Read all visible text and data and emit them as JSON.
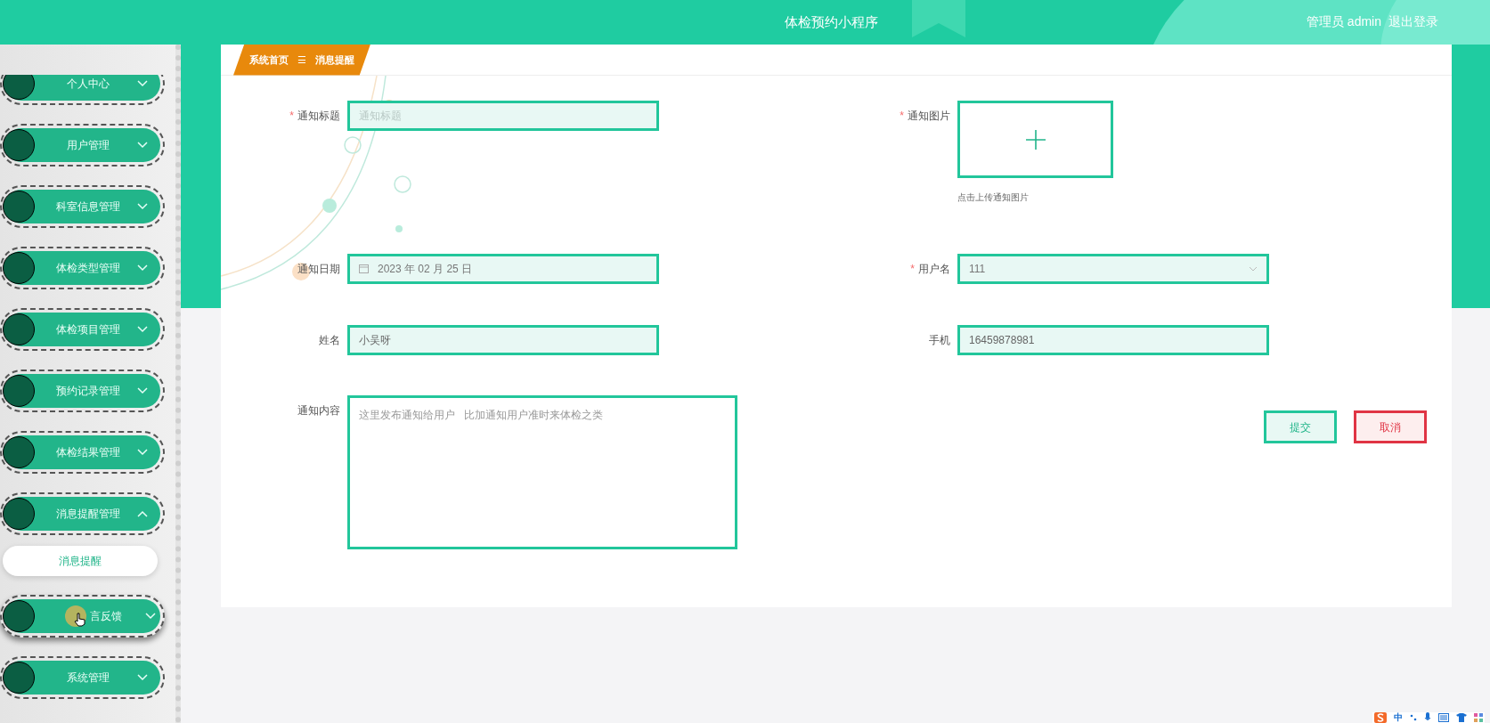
{
  "header": {
    "title": "体检预约小程序",
    "user": "管理员 admin",
    "logout": "退出登录"
  },
  "sidebar": {
    "items": [
      {
        "label": "个人中心",
        "expanded": false,
        "hovered": false
      },
      {
        "label": "用户管理",
        "expanded": false,
        "hovered": false
      },
      {
        "label": "科室信息管理",
        "expanded": false,
        "hovered": false
      },
      {
        "label": "体检类型管理",
        "expanded": false,
        "hovered": false
      },
      {
        "label": "体检项目管理",
        "expanded": false,
        "hovered": false
      },
      {
        "label": "预约记录管理",
        "expanded": false,
        "hovered": false
      },
      {
        "label": "体检结果管理",
        "expanded": false,
        "hovered": false
      },
      {
        "label": "消息提醒管理",
        "expanded": true,
        "hovered": false,
        "children": [
          {
            "label": "消息提醒",
            "selected": true
          }
        ]
      },
      {
        "label": "言反馈",
        "expanded": false,
        "hovered": true
      },
      {
        "label": "系统管理",
        "expanded": false,
        "hovered": false
      }
    ]
  },
  "breadcrumb": {
    "home": "系统首页",
    "separator": "☰",
    "current": "消息提醒"
  },
  "form": {
    "rows": [
      [
        {
          "kind": "text",
          "label": "通知标题",
          "required_mark": "*",
          "placeholder": "通知标题"
        },
        {
          "kind": "upload",
          "label": "通知图片",
          "required_mark": "*",
          "hint": "点击上传通知图片"
        }
      ],
      [
        {
          "kind": "date",
          "label": "通知日期",
          "value": "2023 年 02 月 25 日"
        },
        {
          "kind": "select",
          "label": "用户名",
          "required_mark": "*",
          "value": "111"
        }
      ],
      [
        {
          "kind": "text",
          "label": "姓名",
          "value": "小吴呀"
        },
        {
          "kind": "text",
          "label": "手机",
          "value": "16459878981"
        }
      ],
      [
        {
          "kind": "textarea",
          "label": "通知内容",
          "placeholder": "这里发布通知给用户   比加通知用户准时来体检之类"
        },
        {
          "kind": "buttons"
        }
      ]
    ]
  },
  "buttons": [
    {
      "label": "提交",
      "kind": "primary"
    },
    {
      "label": "取消",
      "kind": "danger"
    }
  ],
  "ime_bar": {
    "indicator": "中"
  }
}
